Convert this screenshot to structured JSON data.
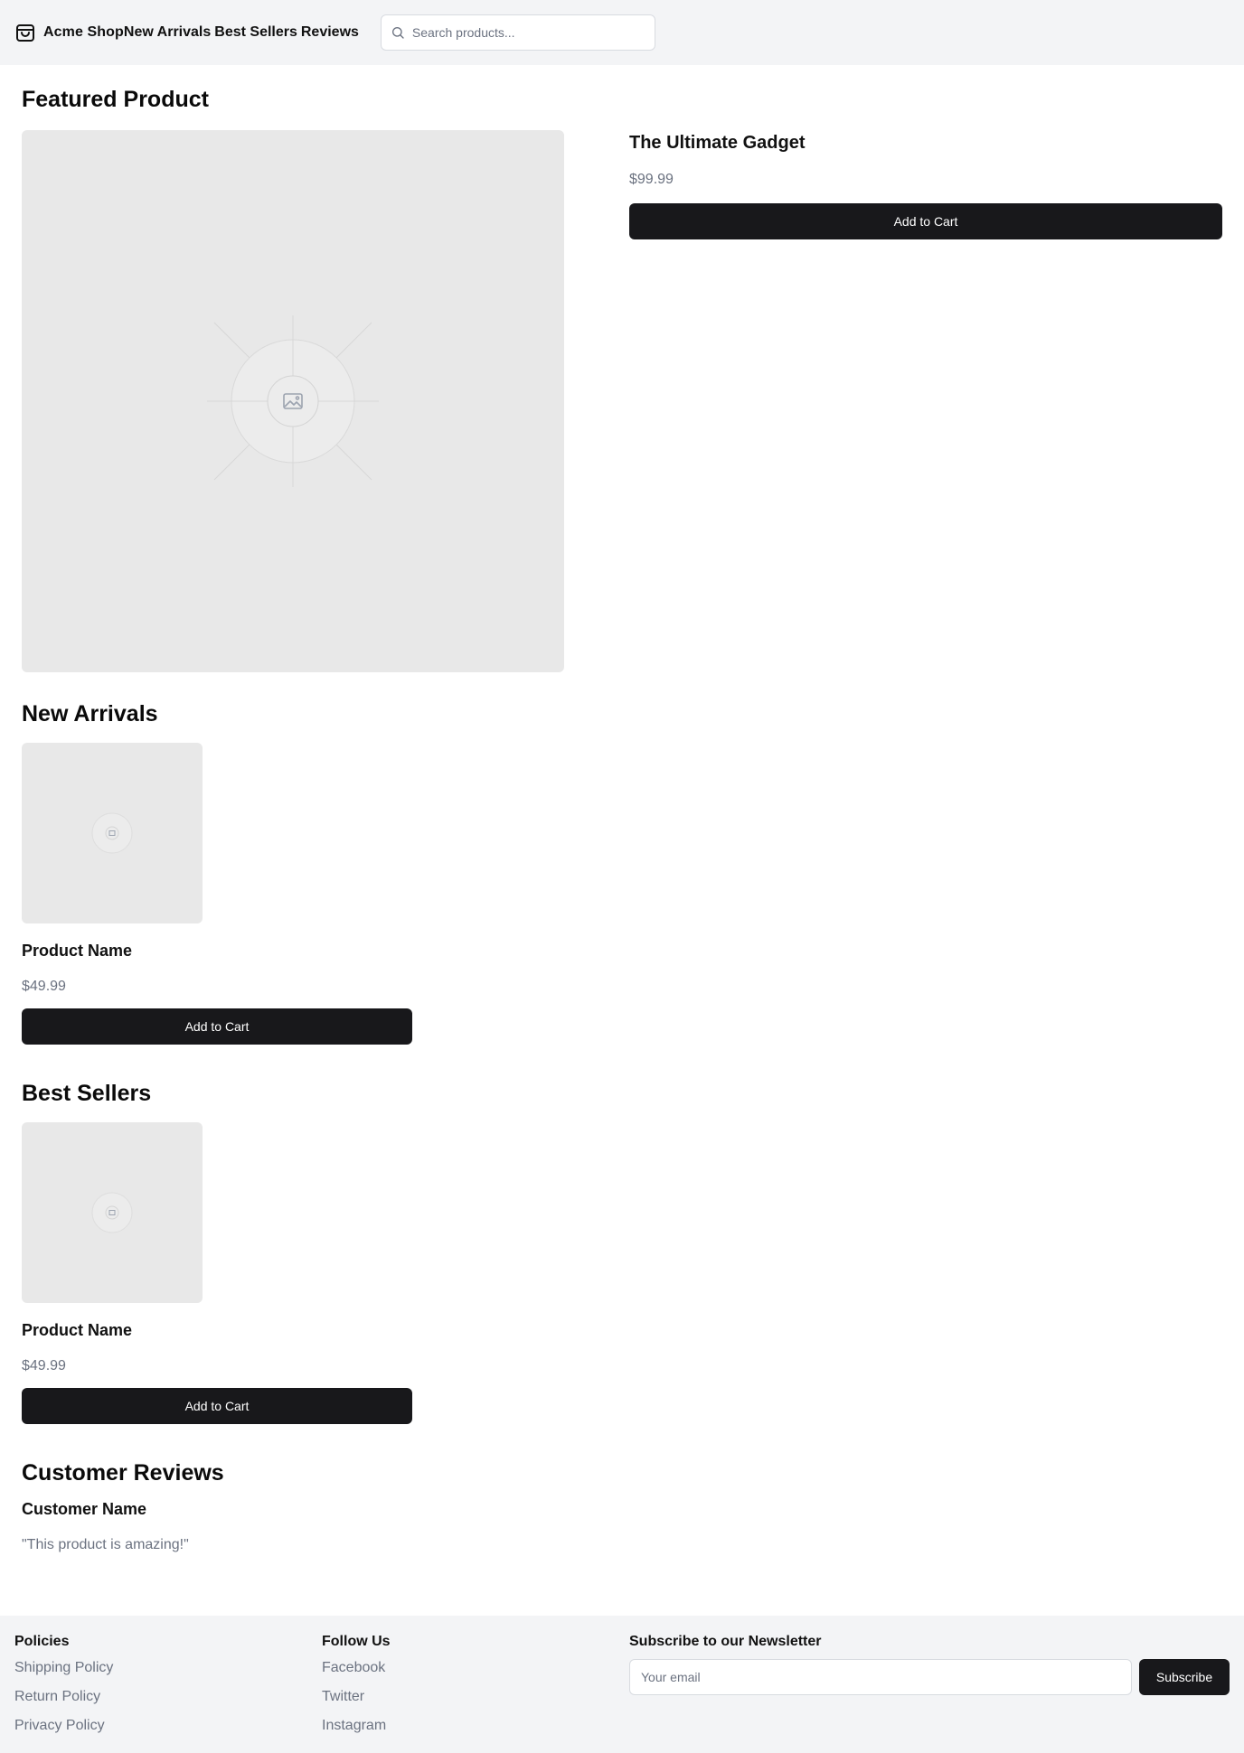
{
  "header": {
    "brand": "Acme Shop",
    "nav": [
      "New Arrivals",
      "Best Sellers",
      "Reviews"
    ],
    "search_placeholder": "Search products..."
  },
  "featured": {
    "title": "Featured Product",
    "name": "The Ultimate Gadget",
    "price": "$99.99",
    "button": "Add to Cart"
  },
  "new_arrivals": {
    "title": "New Arrivals",
    "name": "Product Name",
    "price": "$49.99",
    "button": "Add to Cart"
  },
  "best_sellers": {
    "title": "Best Sellers",
    "name": "Product Name",
    "price": "$49.99",
    "button": "Add to Cart"
  },
  "reviews": {
    "title": "Customer Reviews",
    "name": "Customer Name",
    "text": "\"This product is amazing!\""
  },
  "footer": {
    "policies": {
      "heading": "Policies",
      "links": [
        "Shipping Policy",
        "Return Policy",
        "Privacy Policy"
      ]
    },
    "follow": {
      "heading": "Follow Us",
      "links": [
        "Facebook",
        "Twitter",
        "Instagram"
      ]
    },
    "newsletter": {
      "heading": "Subscribe to our Newsletter",
      "placeholder": "Your email",
      "button": "Subscribe"
    }
  },
  "icons": {
    "brand": "shopping-bag-icon",
    "search": "search-icon",
    "placeholder_image": "image-placeholder-icon"
  },
  "colors": {
    "header_bg": "#f3f4f6",
    "button_bg": "#18181b",
    "muted_text": "#6b7280",
    "image_bg": "#e8e8e8"
  }
}
